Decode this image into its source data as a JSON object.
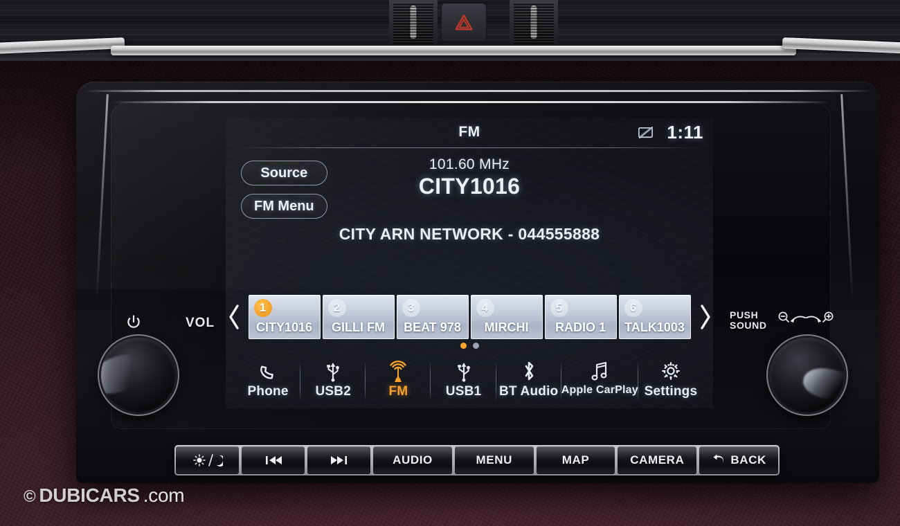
{
  "device": {
    "type": "car-infotainment-head-unit",
    "brand_context": "Nissan-style audio system"
  },
  "status_bar": {
    "title": "FM",
    "clock": "1:11",
    "icons": [
      {
        "name": "display-off-icon",
        "glyph": "screen-crossed-out"
      }
    ]
  },
  "side_buttons": [
    {
      "label": "Source",
      "name": "source-button"
    },
    {
      "label": "FM Menu",
      "name": "fm-menu-button"
    }
  ],
  "now_playing": {
    "frequency": "101.60 MHz",
    "station_name": "CITY1016",
    "radio_text": "CITY ARN NETWORK - 044555888"
  },
  "presets": {
    "prev_label": "‹",
    "next_label": "›",
    "items": [
      {
        "number": "1",
        "name": "CITY1016",
        "active": true
      },
      {
        "number": "2",
        "name": "GILLI FM",
        "active": false
      },
      {
        "number": "3",
        "name": "BEAT 978",
        "active": false
      },
      {
        "number": "4",
        "name": "MIRCHI",
        "active": false
      },
      {
        "number": "5",
        "name": "RADIO 1",
        "active": false
      },
      {
        "number": "6",
        "name": "TALK1003",
        "active": false
      }
    ],
    "pages": 2,
    "current_page": 1
  },
  "bottom_nav": [
    {
      "label": "Phone",
      "icon": "phone-icon",
      "active": false
    },
    {
      "label": "USB2",
      "icon": "usb-icon",
      "active": false
    },
    {
      "label": "FM",
      "icon": "radio-tower-icon",
      "active": true
    },
    {
      "label": "USB1",
      "icon": "usb-icon",
      "active": false
    },
    {
      "label": "BT Audio",
      "icon": "bluetooth-icon",
      "active": false
    },
    {
      "label": "Apple CarPlay",
      "icon": "music-note-icon",
      "active": false
    },
    {
      "label": "Settings",
      "icon": "gear-icon",
      "active": false
    }
  ],
  "left_controls": {
    "power_icon": "power-icon",
    "vol_label": "VOL",
    "knob": "volume-knob"
  },
  "right_controls": {
    "push_sound_line1": "PUSH",
    "push_sound_line2": "SOUND",
    "zoom_out_icon": "zoom-out-icon",
    "zoom_in_icon": "zoom-in-icon",
    "knob": "tune-knob"
  },
  "hard_buttons": [
    {
      "label": "",
      "icon": "day-night-icon",
      "name": "display-brightness-button"
    },
    {
      "label": "",
      "icon": "prev-track-icon",
      "name": "previous-track-button"
    },
    {
      "label": "",
      "icon": "next-track-icon",
      "name": "next-track-button"
    },
    {
      "label": "AUDIO",
      "icon": "",
      "name": "audio-button"
    },
    {
      "label": "MENU",
      "icon": "",
      "name": "menu-button"
    },
    {
      "label": "MAP",
      "icon": "",
      "name": "map-button"
    },
    {
      "label": "CAMERA",
      "icon": "",
      "name": "camera-button"
    },
    {
      "label": "BACK",
      "icon": "back-arrow-icon",
      "name": "back-button"
    }
  ],
  "dashboard": {
    "hazard_icon": "hazard-triangle-icon"
  },
  "watermark": {
    "copyright": "©",
    "brand": "DUBICARS",
    "tld": ".com"
  },
  "colors": {
    "accent_orange": "#f7a52b",
    "screen_bg": "#15161c",
    "text_primary": "#eef0f6",
    "preset_face": "#c3cbda",
    "leather": "#4a2531",
    "hazard_red": "#c0392b"
  }
}
